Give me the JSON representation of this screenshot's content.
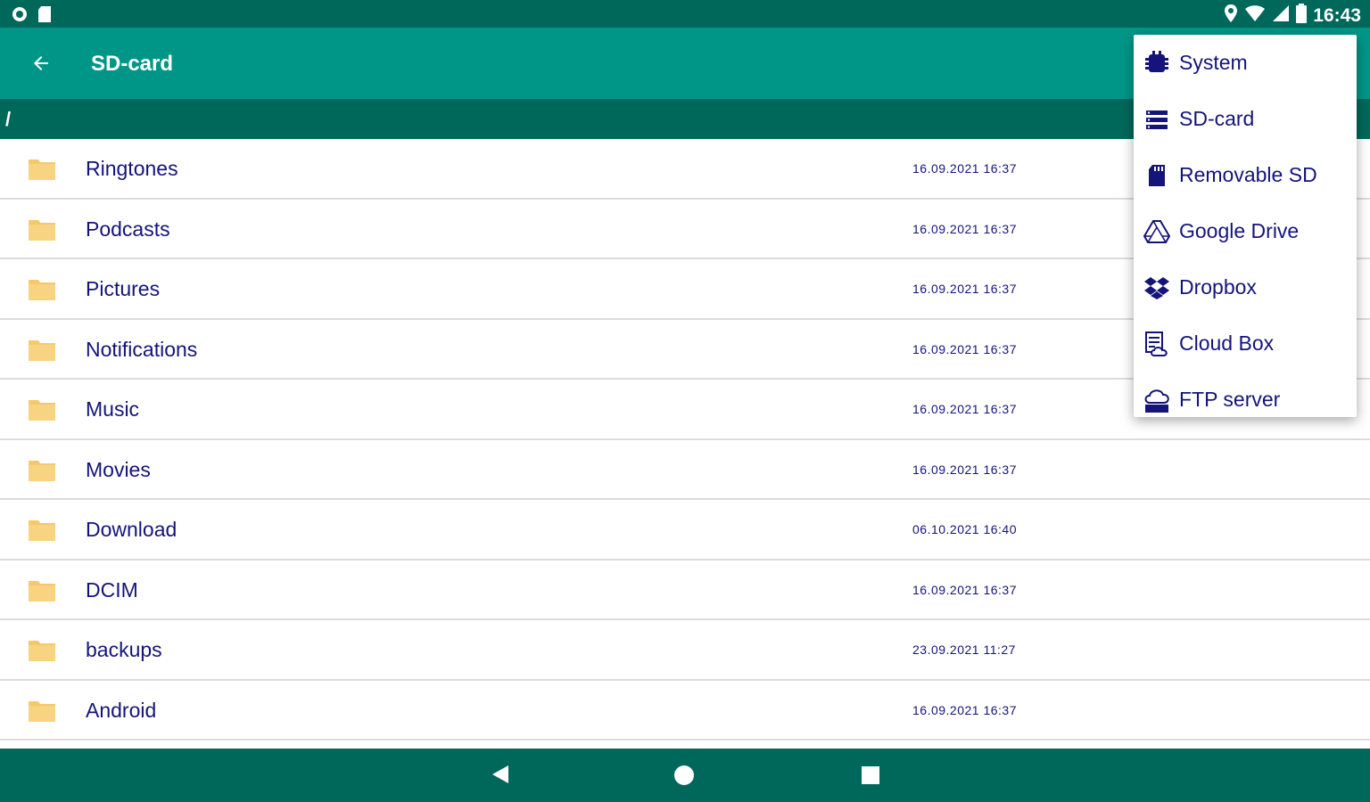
{
  "status_bar": {
    "time": "16:43"
  },
  "app_bar": {
    "title": "SD-card"
  },
  "path_bar": {
    "path": "/"
  },
  "files": [
    {
      "name": "Ringtones",
      "modified": "16.09.2021 16:37"
    },
    {
      "name": "Podcasts",
      "modified": "16.09.2021 16:37"
    },
    {
      "name": "Pictures",
      "modified": "16.09.2021 16:37"
    },
    {
      "name": "Notifications",
      "modified": "16.09.2021 16:37"
    },
    {
      "name": "Music",
      "modified": "16.09.2021 16:37"
    },
    {
      "name": "Movies",
      "modified": "16.09.2021 16:37"
    },
    {
      "name": "Download",
      "modified": "06.10.2021 16:40"
    },
    {
      "name": "DCIM",
      "modified": "16.09.2021 16:37"
    },
    {
      "name": "backups",
      "modified": "23.09.2021 11:27"
    },
    {
      "name": "Android",
      "modified": "16.09.2021 16:37"
    }
  ],
  "storage_menu": {
    "items": [
      {
        "label": "System",
        "icon": "chip-icon"
      },
      {
        "label": "SD-card",
        "icon": "storage-list-icon"
      },
      {
        "label": "Removable SD",
        "icon": "sd-card-icon"
      },
      {
        "label": "Google Drive",
        "icon": "google-drive-icon"
      },
      {
        "label": "Dropbox",
        "icon": "dropbox-icon"
      },
      {
        "label": "Cloud Box",
        "icon": "cloud-box-icon"
      },
      {
        "label": "FTP server",
        "icon": "ftp-cloud-icon"
      }
    ]
  },
  "colors": {
    "status_bar": "#00685a",
    "app_bar": "#009687",
    "path_bar": "#00685a",
    "nav_bar": "#00685a",
    "text": "#14147a",
    "folder": "#f5c86a",
    "divider": "#dcdcdc"
  }
}
